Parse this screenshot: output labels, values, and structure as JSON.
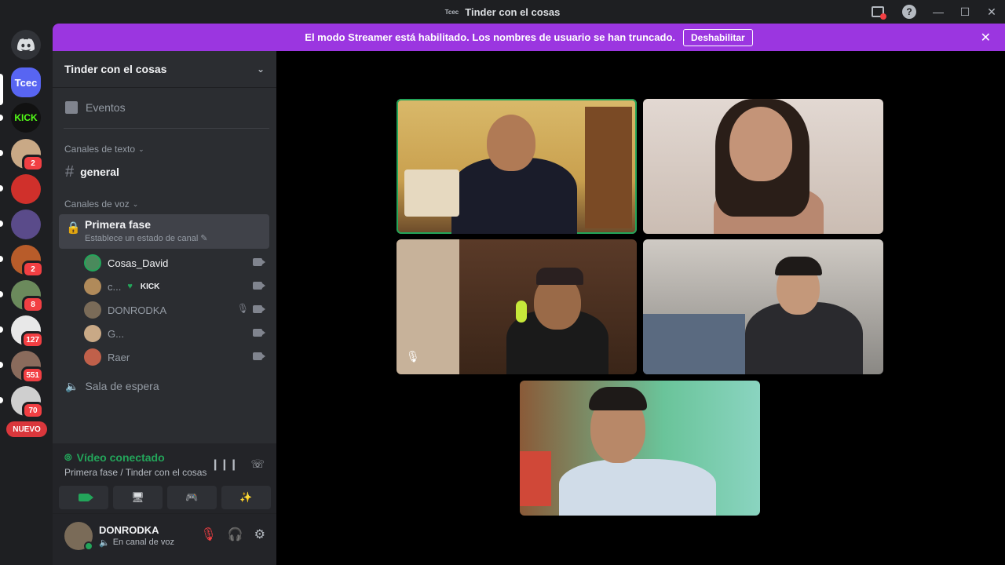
{
  "window": {
    "title": "Tinder con el cosas",
    "logo_text": "Tcec"
  },
  "banner": {
    "message": "El modo Streamer está habilitado. Los nombres de usuario se han truncado.",
    "button_label": "Deshabilitar"
  },
  "guilds": {
    "items": [
      {
        "label": "Tcec",
        "color": "#5865f2"
      },
      {
        "label": "KICK",
        "color": "#111111"
      },
      {
        "label": "",
        "color": "#c9a986",
        "badge": "2"
      },
      {
        "label": "",
        "color": "#d0302b"
      },
      {
        "label": "",
        "color": "#5a4b8a"
      },
      {
        "label": "",
        "color": "#b85c2a",
        "badge": "2"
      },
      {
        "label": "",
        "color": "#6b8a5c",
        "badge": "8"
      },
      {
        "label": "",
        "color": "#e8e8e8",
        "badge": "127"
      },
      {
        "label": "",
        "color": "#8a6b5c",
        "badge": "551"
      },
      {
        "label": "",
        "color": "#cfcfcf",
        "badge": "70"
      }
    ],
    "nuevo_label": "NUEVO"
  },
  "sidebar": {
    "server_name": "Tinder con el cosas",
    "events_label": "Eventos",
    "text_category": "Canales de texto",
    "general_channel": "general",
    "voice_category": "Canales de voz",
    "voice_channel": {
      "name": "Primera fase",
      "status": "Establece un estado de canal"
    },
    "members": [
      {
        "name": "Cosas_David",
        "color": "#4a8a5c",
        "active": true
      },
      {
        "name": "c...",
        "color": "#b08a5a",
        "tag": "KICK"
      },
      {
        "name": "DONRODKA",
        "color": "#7a6b58",
        "muted": true
      },
      {
        "name": "G...",
        "color": "#c9a986"
      },
      {
        "name": "Raer",
        "color": "#c0604a"
      }
    ],
    "waiting_room": "Sala de espera"
  },
  "voice_panel": {
    "status": "Vídeo conectado",
    "location": "Primera fase / Tinder con el cosas"
  },
  "user": {
    "name": "DONRODKA",
    "status": "En canal de voz"
  },
  "icons": {
    "inbox": "inbox-icon",
    "help": "help-icon"
  },
  "colors": {
    "accent_green": "#23a55a",
    "streamer_banner": "#9b36e0",
    "mention_red": "#f23f43"
  }
}
